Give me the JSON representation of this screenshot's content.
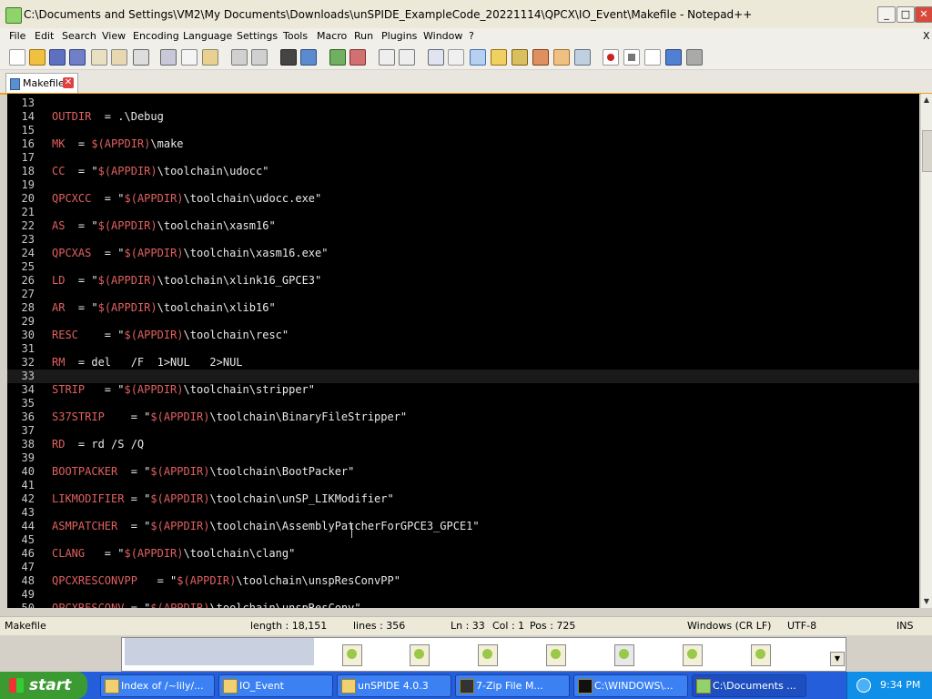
{
  "window": {
    "title": "C:\\Documents and Settings\\VM2\\My Documents\\Downloads\\unSPIDE_ExampleCode_20221114\\QPCX\\IO_Event\\Makefile - Notepad++",
    "minimize": "_",
    "maximize": "□",
    "close": "✕"
  },
  "menu": [
    "File",
    "Edit",
    "Search",
    "View",
    "Encoding",
    "Language",
    "Settings",
    "Tools",
    "Macro",
    "Run",
    "Plugins",
    "Window",
    "?"
  ],
  "menu_close": "X",
  "toolbar_icons": [
    "new-file-icon",
    "open-file-icon",
    "save-icon",
    "save-all-icon",
    "close-icon",
    "close-all-icon",
    "print-icon",
    "cut-icon",
    "copy-icon",
    "paste-icon",
    "undo-icon",
    "redo-icon",
    "find-icon",
    "replace-icon",
    "zoom-in-icon",
    "zoom-out-icon",
    "sync-v-icon",
    "sync-h-icon",
    "wrap-icon",
    "all-chars-icon",
    "indent-guide-icon",
    "udl-icon",
    "doc-map-icon",
    "function-list-icon",
    "folder-workspace-icon",
    "monitor-icon",
    "record-macro-icon",
    "stop-macro-icon",
    "play-macro-icon",
    "run-macro-multiple-icon",
    "save-macro-icon"
  ],
  "tab": {
    "label": "Makefile",
    "close": "✕"
  },
  "editor": {
    "lines": [
      {
        "n": "13",
        "code": ""
      },
      {
        "n": "14",
        "code": "OUTDIR  = .\\Debug"
      },
      {
        "n": "15",
        "code": ""
      },
      {
        "n": "16",
        "code": "MK  = $(APPDIR)\\make"
      },
      {
        "n": "17",
        "code": ""
      },
      {
        "n": "18",
        "code": "CC  = \"$(APPDIR)\\toolchain\\udocc\""
      },
      {
        "n": "19",
        "code": ""
      },
      {
        "n": "20",
        "code": "QPCXCC  = \"$(APPDIR)\\toolchain\\udocc.exe\""
      },
      {
        "n": "21",
        "code": ""
      },
      {
        "n": "22",
        "code": "AS  = \"$(APPDIR)\\toolchain\\xasm16\""
      },
      {
        "n": "23",
        "code": ""
      },
      {
        "n": "24",
        "code": "QPCXAS  = \"$(APPDIR)\\toolchain\\xasm16.exe\""
      },
      {
        "n": "25",
        "code": ""
      },
      {
        "n": "26",
        "code": "LD  = \"$(APPDIR)\\toolchain\\xlink16_GPCE3\""
      },
      {
        "n": "27",
        "code": ""
      },
      {
        "n": "28",
        "code": "AR  = \"$(APPDIR)\\toolchain\\xlib16\""
      },
      {
        "n": "29",
        "code": ""
      },
      {
        "n": "30",
        "code": "RESC    = \"$(APPDIR)\\toolchain\\resc\""
      },
      {
        "n": "31",
        "code": ""
      },
      {
        "n": "32",
        "code": "RM  = del   /F  1>NUL   2>NUL"
      },
      {
        "n": "33",
        "code": ""
      },
      {
        "n": "34",
        "code": "STRIP   = \"$(APPDIR)\\toolchain\\stripper\""
      },
      {
        "n": "35",
        "code": ""
      },
      {
        "n": "36",
        "code": "S37STRIP    = \"$(APPDIR)\\toolchain\\BinaryFileStripper\""
      },
      {
        "n": "37",
        "code": ""
      },
      {
        "n": "38",
        "code": "RD  = rd /S /Q"
      },
      {
        "n": "39",
        "code": ""
      },
      {
        "n": "40",
        "code": "BOOTPACKER  = \"$(APPDIR)\\toolchain\\BootPacker\""
      },
      {
        "n": "41",
        "code": ""
      },
      {
        "n": "42",
        "code": "LIKMODIFIER = \"$(APPDIR)\\toolchain\\unSP_LIKModifier\""
      },
      {
        "n": "43",
        "code": ""
      },
      {
        "n": "44",
        "code": "ASMPATCHER  = \"$(APPDIR)\\toolchain\\AssemblyPatcherForGPCE3_GPCE1\""
      },
      {
        "n": "45",
        "code": ""
      },
      {
        "n": "46",
        "code": "CLANG   = \"$(APPDIR)\\toolchain\\clang\""
      },
      {
        "n": "47",
        "code": ""
      },
      {
        "n": "48",
        "code": "QPCXRESCONVPP   = \"$(APPDIR)\\toolchain\\unspResConvPP\""
      },
      {
        "n": "49",
        "code": ""
      },
      {
        "n": "50",
        "code": "QPCXRESCONV = \"$(APPDIR)\\toolchain\\unspResConv\""
      }
    ],
    "active_line": "33"
  },
  "status": {
    "file_type": "Makefile",
    "length": "length : 18,151",
    "lines": "lines : 356",
    "ln": "Ln : 33",
    "col": "Col : 1",
    "pos": "Pos : 725",
    "eol": "Windows (CR LF)",
    "encoding": "UTF-8",
    "mode": "INS"
  },
  "taskbar": {
    "start": "start",
    "tasks": [
      "Index of /~lily/...",
      "IO_Event",
      "unSPIDE 4.0.3",
      "7-Zip File M...",
      "C:\\WINDOWS\\...",
      "C:\\Documents ..."
    ],
    "clock": "9:34 PM"
  }
}
